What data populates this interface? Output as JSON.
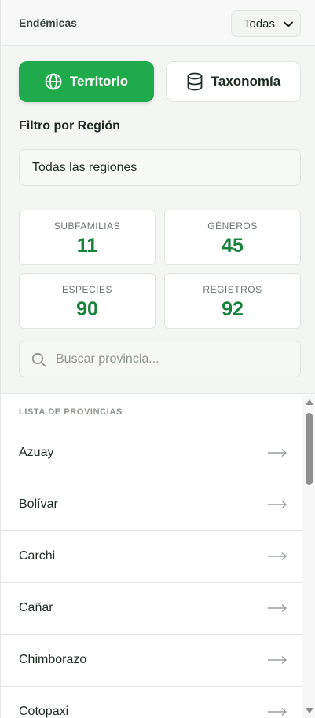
{
  "header": {
    "title": "Endémicas",
    "filter_value": "Todas"
  },
  "tabs": [
    {
      "label": "Territorio",
      "icon": "globe-icon",
      "active": true
    },
    {
      "label": "Taxonomía",
      "icon": "database-icon",
      "active": false
    }
  ],
  "region_filter": {
    "label": "Filtro por Región",
    "value": "Todas las regiones"
  },
  "stats": [
    {
      "label": "SUBFAMILIAS",
      "value": "11"
    },
    {
      "label": "GÉNEROS",
      "value": "45"
    },
    {
      "label": "ESPECIES",
      "value": "90"
    },
    {
      "label": "REGISTROS",
      "value": "92"
    }
  ],
  "search": {
    "placeholder": "Buscar provincia...",
    "value": ""
  },
  "province_list": {
    "header": "LISTA DE PROVINCIAS",
    "items": [
      "Azuay",
      "Bolívar",
      "Carchi",
      "Cañar",
      "Chimborazo",
      "Cotopaxi"
    ]
  },
  "colors": {
    "accent": "#1faa4b",
    "stat_value": "#18813c"
  }
}
